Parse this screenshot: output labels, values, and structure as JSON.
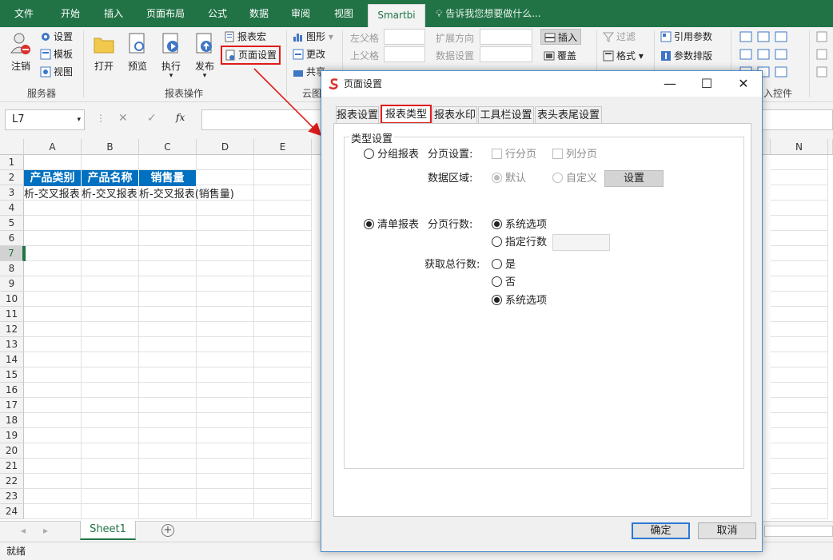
{
  "ribbon_tabs": [
    {
      "label": "文件"
    },
    {
      "label": "开始"
    },
    {
      "label": "插入"
    },
    {
      "label": "页面布局"
    },
    {
      "label": "公式"
    },
    {
      "label": "数据"
    },
    {
      "label": "审阅"
    },
    {
      "label": "视图"
    },
    {
      "label": "Smartbi"
    }
  ],
  "tell_me": "告诉我您想要做什么...",
  "ribbon": {
    "server": {
      "logout": "注销",
      "settings": "设置",
      "template": "模板",
      "view": "视图",
      "group": "服务器"
    },
    "report_ops": {
      "open": "打开",
      "preview": "预览",
      "execute": "执行",
      "publish": "发布",
      "macro": "报表宏",
      "page_setup": "页面设置",
      "group": "报表操作"
    },
    "cloud": {
      "chart": "图形",
      "change": "更改",
      "share": "共享",
      "group": "云图"
    },
    "cell": {
      "left_parent": "左父格",
      "top_parent": "上父格",
      "expand_dir": "扩展方向",
      "data_setting": "数据设置"
    },
    "insert_group": {
      "insert": "插入",
      "overwrite": "覆盖"
    },
    "filter": {
      "filter": "过滤",
      "format": "格式"
    },
    "params": {
      "ref_param": "引用参数",
      "param_layout": "参数排版"
    },
    "controls_group": "入控件"
  },
  "formula_bar": {
    "name_box": "L7",
    "fx": "fx"
  },
  "grid": {
    "columns": [
      "A",
      "B",
      "C",
      "D",
      "E",
      "N"
    ],
    "rows": [
      "1",
      "2",
      "3",
      "4",
      "5",
      "6",
      "7",
      "8",
      "9",
      "10",
      "11",
      "12",
      "13",
      "14",
      "15",
      "16",
      "17",
      "18",
      "19",
      "20",
      "21",
      "22",
      "23",
      "24"
    ],
    "headers": [
      "产品类别",
      "产品名称",
      "销售量"
    ],
    "row3": [
      "析-交叉报表",
      "析-交叉报表",
      "析-交叉报表(销售量)"
    ]
  },
  "sheet_tab": "Sheet1",
  "status": "就绪",
  "dialog": {
    "title": "页面设置",
    "tabs": [
      "报表设置",
      "报表类型",
      "报表水印",
      "工具栏设置",
      "表头表尾设置"
    ],
    "legend": "类型设置",
    "group_report": "分组报表",
    "paging_setting": "分页设置:",
    "row_paging": "行分页",
    "col_paging": "列分页",
    "data_area": "数据区域:",
    "default": "默认",
    "custom": "自定义",
    "set_btn": "设置",
    "list_report": "清单报表",
    "page_rows": "分页行数:",
    "system_option": "系统选项",
    "specified_rows": "指定行数",
    "get_total": "获取总行数:",
    "yes": "是",
    "no": "否",
    "system_option2": "系统选项",
    "ok": "确定",
    "cancel": "取消"
  },
  "colors": {
    "excel_green": "#217346",
    "header_blue": "#0070c0",
    "highlight_red": "#e01b1b"
  }
}
